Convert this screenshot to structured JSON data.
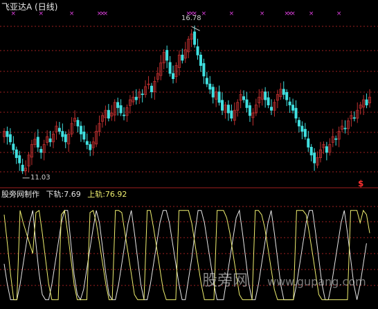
{
  "title": "飞亚达A (日线)",
  "high_label": "16.78",
  "low_label": "11.03",
  "signal_mark": "$",
  "indicator": {
    "name": "股旁网制作",
    "lower_label": "下轨:7.69",
    "upper_label": "上轨:76.92"
  },
  "watermark": "股旁网",
  "watermark_url": "www.gupang.com",
  "colors": {
    "background": "#000000",
    "up_candle": "#c03030",
    "down_candle": "#40e0e0",
    "gridline": "#a02020",
    "marker": "#e040e0",
    "upper_line": "#f0f070",
    "lower_line": "#e8e8e8",
    "signal": "#ff3030"
  },
  "chart_data": {
    "type": "candlestick",
    "ylim": [
      11.0,
      17.0
    ],
    "high": 16.78,
    "low": 11.03,
    "close": [
      12.8,
      12.6,
      12.4,
      12.1,
      11.8,
      11.6,
      11.3,
      11.4,
      11.9,
      12.3,
      12.5,
      12.2,
      12.0,
      12.3,
      12.6,
      12.4,
      12.7,
      13.0,
      12.8,
      12.6,
      12.4,
      12.7,
      13.1,
      13.3,
      13.0,
      12.7,
      12.5,
      12.3,
      12.1,
      12.4,
      12.8,
      13.1,
      13.4,
      13.6,
      13.3,
      13.5,
      13.9,
      13.7,
      13.5,
      13.4,
      13.7,
      14.0,
      14.1,
      14.0,
      14.3,
      14.2,
      14.5,
      14.6,
      14.3,
      14.7,
      15.0,
      15.4,
      15.8,
      15.5,
      15.0,
      14.8,
      15.3,
      15.7,
      15.5,
      15.9,
      16.3,
      16.5,
      16.1,
      15.7,
      15.3,
      14.9,
      14.6,
      14.4,
      14.1,
      14.3,
      13.9,
      13.6,
      13.8,
      13.5,
      13.3,
      13.6,
      13.9,
      14.2,
      14.0,
      13.7,
      13.4,
      13.5,
      13.8,
      14.1,
      14.3,
      14.0,
      13.8,
      13.6,
      13.9,
      14.2,
      14.4,
      14.2,
      14.0,
      13.8,
      13.6,
      13.3,
      13.0,
      12.8,
      12.6,
      12.2,
      11.9,
      11.6,
      11.8,
      12.1,
      12.3,
      12.0,
      12.3,
      12.6,
      12.5,
      12.8,
      13.0,
      12.9,
      13.2,
      13.4,
      13.3,
      13.6,
      13.8,
      14.0,
      13.8,
      14.1
    ]
  },
  "band_data": {
    "ylim": [
      0,
      100
    ],
    "upper": [
      88,
      60,
      30,
      5,
      5,
      92,
      80,
      70,
      60,
      50,
      90,
      92,
      70,
      45,
      20,
      5,
      5,
      5,
      88,
      92,
      70,
      45,
      20,
      5,
      5,
      5,
      5,
      90,
      92,
      80,
      60,
      40,
      20,
      5,
      5,
      92,
      92,
      90,
      70,
      50,
      30,
      10,
      5,
      5,
      5,
      92,
      92,
      75,
      55,
      35,
      15,
      5,
      5,
      5,
      5,
      92,
      92,
      92,
      92,
      80,
      60,
      40,
      20,
      5,
      5,
      5,
      5,
      92,
      92,
      92,
      85,
      70,
      50,
      30,
      10,
      5,
      5,
      5,
      5,
      92,
      92,
      88,
      75,
      55,
      35,
      15,
      5,
      5,
      5,
      5,
      5,
      5,
      92,
      92,
      92,
      88,
      70,
      50,
      30,
      10,
      5,
      5,
      5,
      5,
      5,
      5,
      5,
      5,
      5,
      92,
      92,
      92,
      80,
      92,
      88,
      70
    ],
    "lower": [
      40,
      20,
      5,
      5,
      5,
      20,
      40,
      60,
      80,
      92,
      60,
      30,
      10,
      5,
      5,
      20,
      40,
      60,
      80,
      92,
      92,
      60,
      30,
      10,
      5,
      15,
      35,
      55,
      75,
      92,
      80,
      55,
      30,
      10,
      5,
      5,
      20,
      40,
      60,
      80,
      92,
      70,
      45,
      20,
      5,
      5,
      20,
      40,
      60,
      80,
      92,
      92,
      80,
      60,
      40,
      20,
      5,
      5,
      25,
      45,
      70,
      92,
      92,
      80,
      60,
      40,
      20,
      5,
      5,
      5,
      25,
      45,
      65,
      85,
      92,
      70,
      45,
      20,
      5,
      5,
      20,
      40,
      60,
      80,
      92,
      70,
      45,
      20,
      5,
      5,
      5,
      5,
      20,
      40,
      60,
      80,
      92,
      92,
      70,
      45,
      20,
      5,
      5,
      20,
      40,
      60,
      80,
      92,
      70,
      45,
      20,
      5,
      20,
      40,
      60
    ]
  },
  "markers": [
    {
      "bar": 3
    },
    {
      "bar": 12
    },
    {
      "bar": 22
    },
    {
      "bar": 31
    },
    {
      "bar": 32
    },
    {
      "bar": 33
    },
    {
      "bar": 60
    },
    {
      "bar": 61
    },
    {
      "bar": 62
    },
    {
      "bar": 65
    },
    {
      "bar": 74
    },
    {
      "bar": 84
    },
    {
      "bar": 92
    },
    {
      "bar": 93
    },
    {
      "bar": 94
    },
    {
      "bar": 100
    },
    {
      "bar": 109
    }
  ]
}
